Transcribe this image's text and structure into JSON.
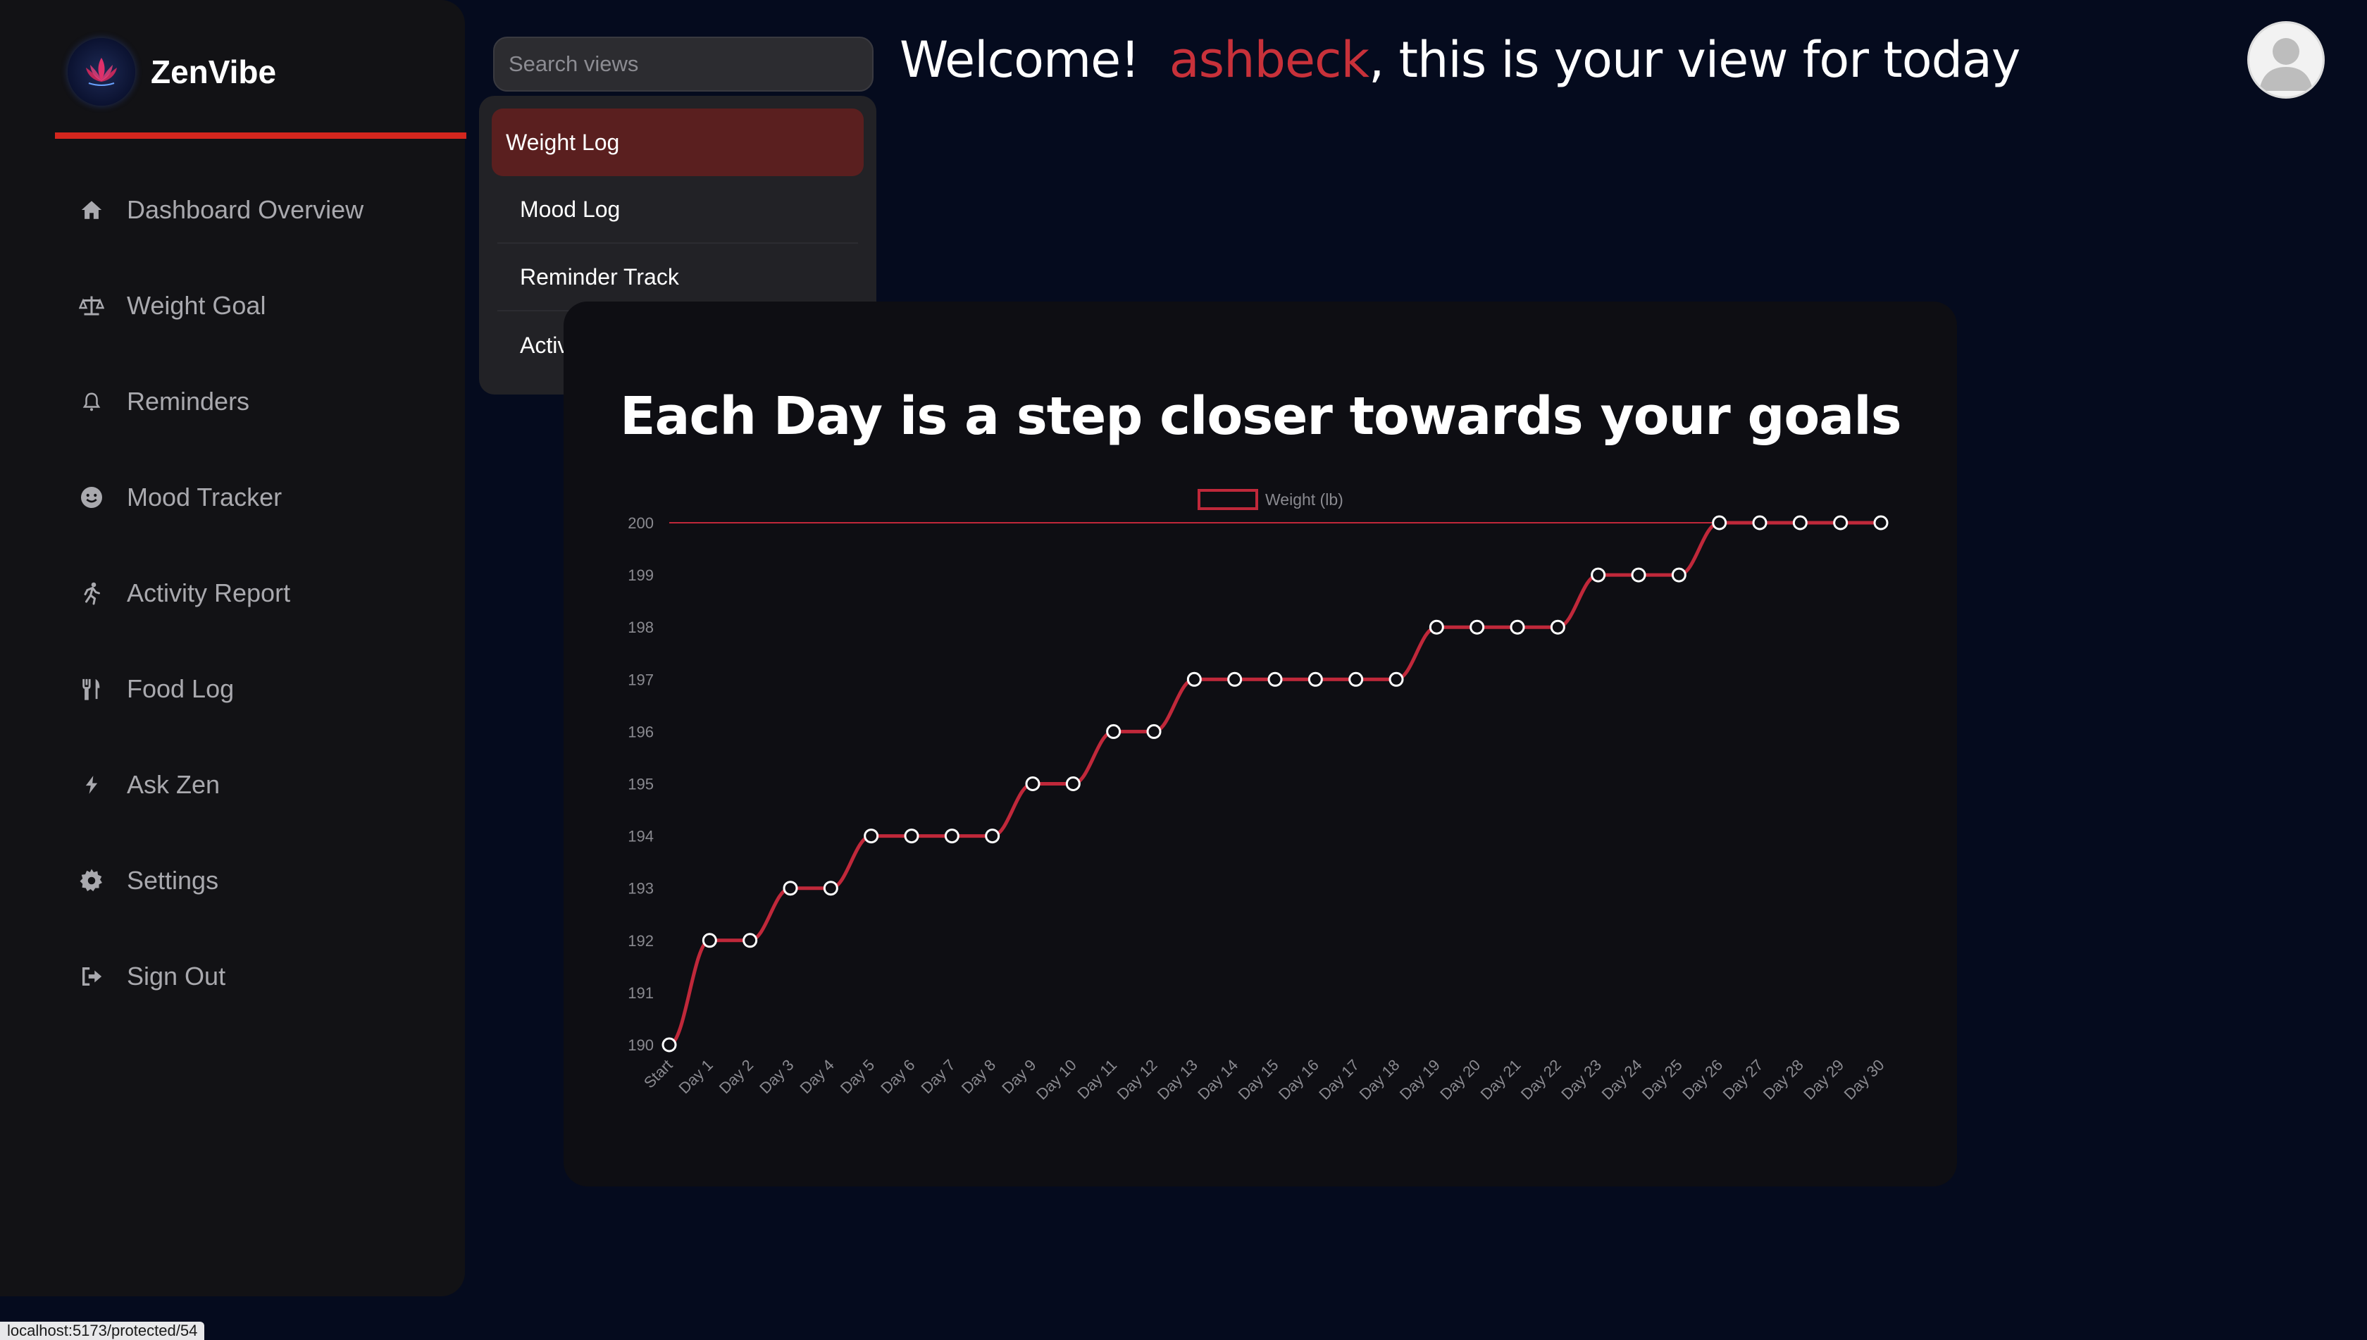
{
  "app": {
    "name": "ZenVibe"
  },
  "sidebar": {
    "items": [
      {
        "label": "Dashboard Overview",
        "icon": "home-icon"
      },
      {
        "label": "Weight Goal",
        "icon": "scale-icon"
      },
      {
        "label": "Reminders",
        "icon": "bell-icon"
      },
      {
        "label": "Mood Tracker",
        "icon": "smile-icon"
      },
      {
        "label": "Activity Report",
        "icon": "running-icon"
      },
      {
        "label": "Food Log",
        "icon": "utensils-icon"
      },
      {
        "label": "Ask Zen",
        "icon": "bolt-icon"
      },
      {
        "label": "Settings",
        "icon": "gear-icon"
      },
      {
        "label": "Sign Out",
        "icon": "sign-out-icon"
      }
    ]
  },
  "search": {
    "placeholder": "Search views"
  },
  "dropdown": {
    "items": [
      "Weight Log",
      "Mood Log",
      "Reminder Track",
      "Activity Track"
    ],
    "active_index": 0
  },
  "header": {
    "welcome_prefix": "Welcome!",
    "username": "ashbeck",
    "welcome_suffix": ", this is your view for today"
  },
  "card": {
    "title": "Each Day is a step closer towards your goals"
  },
  "colors": {
    "accent": "#c8313a",
    "line": "#c0283a",
    "background": "#050b1e",
    "card": "#0e0e13",
    "sidebar": "#121215"
  },
  "chart_data": {
    "type": "line",
    "categories": [
      "Start",
      "Day 1",
      "Day 2",
      "Day 3",
      "Day 4",
      "Day 5",
      "Day 6",
      "Day 7",
      "Day 8",
      "Day 9",
      "Day 10",
      "Day 11",
      "Day 12",
      "Day 13",
      "Day 14",
      "Day 15",
      "Day 16",
      "Day 17",
      "Day 18",
      "Day 19",
      "Day 20",
      "Day 21",
      "Day 22",
      "Day 23",
      "Day 24",
      "Day 25",
      "Day 26",
      "Day 27",
      "Day 28",
      "Day 29",
      "Day 30"
    ],
    "series": [
      {
        "name": "Weight (lb)",
        "values": [
          190,
          192,
          192,
          193,
          193,
          194,
          194,
          194,
          194,
          195,
          195,
          196,
          196,
          197,
          197,
          197,
          197,
          197,
          197,
          198,
          198,
          198,
          198,
          199,
          199,
          199,
          200,
          200,
          200,
          200,
          200
        ]
      }
    ],
    "yticks": [
      190,
      191,
      192,
      193,
      194,
      195,
      196,
      197,
      198,
      199,
      200
    ],
    "ylim": [
      190,
      200
    ],
    "legend": "top-center",
    "grid": false
  },
  "status": {
    "url": "localhost:5173/protected/54"
  }
}
